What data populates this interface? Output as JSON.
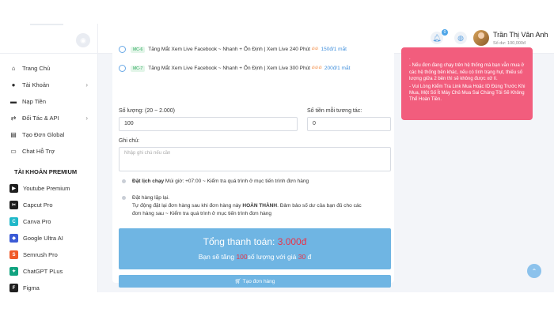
{
  "sidebar": {
    "menu": [
      {
        "label": "Trang Chủ",
        "icon": "home-icon",
        "glyph": "⌂",
        "chev": ""
      },
      {
        "label": "Tài Khoản",
        "icon": "user-icon",
        "glyph": "●",
        "chev": "›"
      },
      {
        "label": "Nạp Tiền",
        "icon": "card-icon",
        "glyph": "▬",
        "chev": ""
      },
      {
        "label": "Đối Tác & API",
        "icon": "partner-icon",
        "glyph": "⇄",
        "chev": "›"
      },
      {
        "label": "Tạo Đơn Global",
        "icon": "order-icon",
        "glyph": "▤",
        "chev": ""
      },
      {
        "label": "Chat Hỗ Trợ",
        "icon": "chat-icon",
        "glyph": "▭",
        "chev": ""
      }
    ],
    "premium_title": "TÀI KHOẢN PREMIUM",
    "premium": [
      {
        "label": "Youtube Premium",
        "icon": "youtube-icon",
        "glyph": "▶",
        "color": "#1f1f1f"
      },
      {
        "label": "Capcut Pro",
        "icon": "capcut-icon",
        "glyph": "✂",
        "color": "#1f1f1f"
      },
      {
        "label": "Canva Pro",
        "icon": "canva-icon",
        "glyph": "C",
        "color": "#20b8c9"
      },
      {
        "label": "Google Ultra AI",
        "icon": "google-ai-icon",
        "glyph": "◆",
        "color": "#3b5bd6"
      },
      {
        "label": "Semrush Pro",
        "icon": "semrush-icon",
        "glyph": "S",
        "color": "#f05a28"
      },
      {
        "label": "ChatGPT PLus",
        "icon": "chatgpt-icon",
        "glyph": "✦",
        "color": "#10a37f"
      },
      {
        "label": "Figma",
        "icon": "figma-icon",
        "glyph": "F",
        "color": "#1f1f1f"
      }
    ]
  },
  "header": {
    "notif_count": "0",
    "user_name": "Trần Thị Vân Anh",
    "balance": "Số dư: 100,000đ"
  },
  "services": [
    {
      "code": "MC-6",
      "name": "Tăng Mắt Xem Live Facebook ~ Nhanh + Ổn Định | Xem Live 240 Phút",
      "price": "150đ/1 mắt"
    },
    {
      "code": "MC-7",
      "name": "Tăng Mắt Xem Live Facebook ~ Nhanh + Ổn Định | Xem Live 300 Phút",
      "price": "200đ/1 mắt"
    }
  ],
  "form": {
    "qty_label": "Số lượng: (20 ~ 2.000)",
    "qty_value": "100",
    "money_label": "Số tiền mỗi tương tác:",
    "money_value": "0",
    "note_label": "Ghi chú:",
    "note_placeholder": "Nhập ghi chú nếu cần",
    "schedule_title": "Đặt lịch chạy",
    "schedule_text": " Múi giờ: +07:00 ~ Kiểm tra quá trình ở mục tiến trình đơn hàng",
    "repeat_title": "Đặt hàng lặp lại.",
    "repeat_text1": "Tự động đặt lại đơn hàng sau khi đơn hàng này ",
    "repeat_bold": "HOÀN THÀNH",
    "repeat_text2": ". Đảm bảo số dư của bạn đủ cho các",
    "repeat_text3": "đơn hàng sau ~ Kiểm tra quá trình ở mục tiến trình đơn hàng"
  },
  "total": {
    "label": "Tổng thanh toán: ",
    "amount": "3.000đ",
    "pre": "Bạn sẽ tăng ",
    "qty": "100",
    "mid": "số lượng với giá ",
    "price": "30",
    "post": " đ"
  },
  "submit_label": "Tạo đơn hàng",
  "note_card": [
    ".",
    "- Nếu đơn đang chạy trên hệ thống mà bạn vẫn mua ở các hệ thống bên khác, nếu có tình trạng hụt, thiếu số lượng giữa 2 bên thì sẽ không được xử lí.",
    "- Vui Lòng Kiểm Tra Link Mua Hoặc ID Đúng Trước Khi Mua, Một Số Ít Máy Chủ Mua Sai Chúng Tôi Sẽ Không Thể Hoàn Tiền."
  ]
}
